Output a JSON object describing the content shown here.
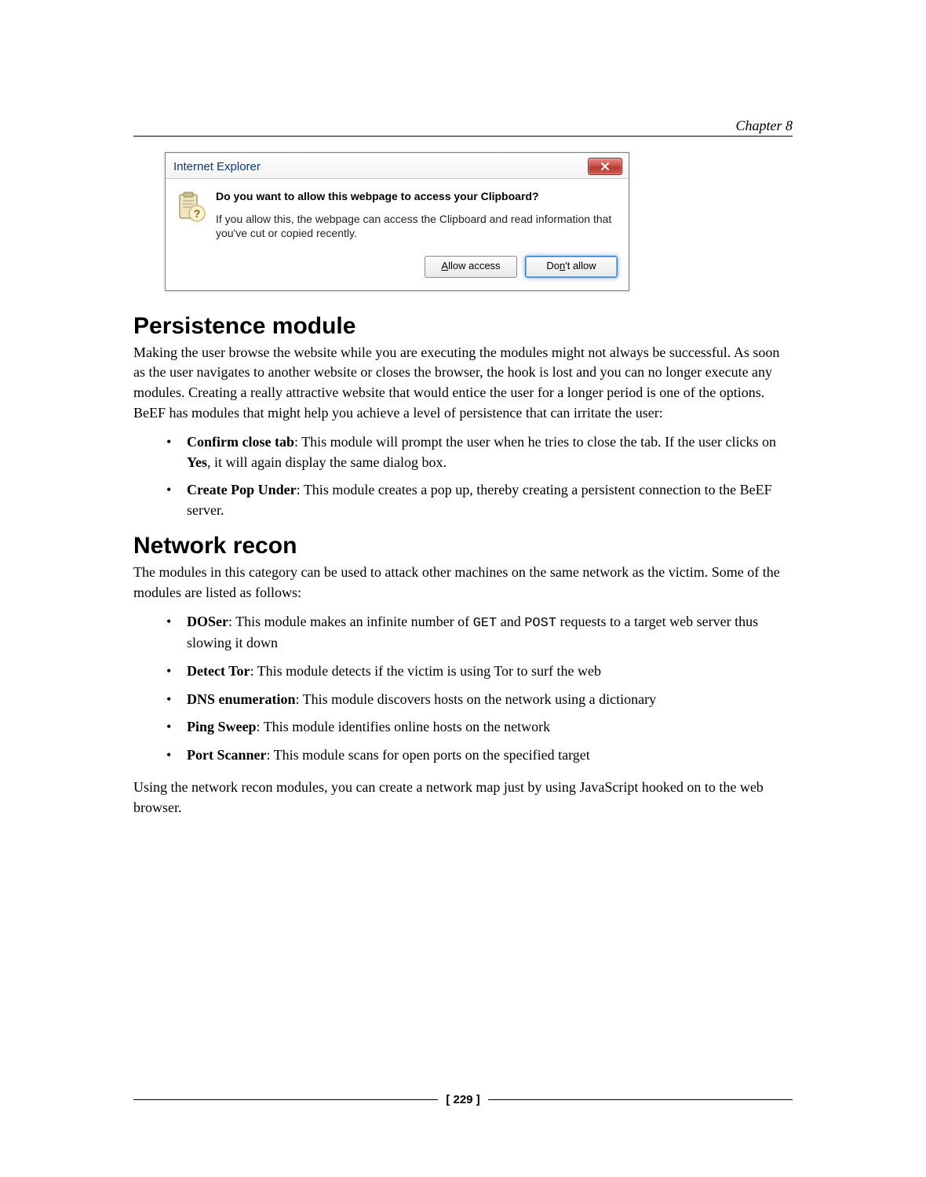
{
  "chapter_label": "Chapter 8",
  "dialog": {
    "title": "Internet Explorer",
    "heading": "Do you want to allow this webpage to access your Clipboard?",
    "message": "If you allow this, the webpage can access the Clipboard and read information that you've cut or copied recently.",
    "allow_prefix": "A",
    "allow_rest": "llow access",
    "dont_prefix": "Do",
    "dont_underline": "n",
    "dont_rest": "'t allow"
  },
  "sections": {
    "persistence": {
      "title": "Persistence module",
      "intro": "Making the user browse the website while you are executing the modules might not always be successful. As soon as the user navigates to another website or closes the browser, the hook is lost and you can no longer execute any modules. Creating a really attractive website that would entice the user for a longer period is one of the options. BeEF has modules that might help you achieve a level of persistence that can irritate the user:",
      "items": [
        {
          "bold": "Confirm close tab",
          "rest_before_yes": ": This module will prompt the user when he tries to close the tab. If the user clicks on ",
          "yes": "Yes",
          "rest_after_yes": ", it will again display the same dialog box."
        },
        {
          "bold": "Create Pop Under",
          "rest": ": This module creates a pop up, thereby creating a persistent connection to the BeEF server."
        }
      ]
    },
    "network": {
      "title": "Network recon",
      "intro": "The modules in this category can be used to attack other machines on the same network as the victim. Some of the modules are listed as follows:",
      "items": [
        {
          "bold": "DOSer",
          "pre": ": This module makes an infinite number of ",
          "code1": "GET",
          "mid": " and ",
          "code2": "POST",
          "post": " requests to a target web server thus slowing it down"
        },
        {
          "bold": "Detect Tor",
          "rest": ": This module detects if the victim is using Tor to surf the web"
        },
        {
          "bold": "DNS enumeration",
          "rest": ": This module discovers hosts on the network using a dictionary"
        },
        {
          "bold": "Ping Sweep",
          "rest": ": This module identifies online hosts on the network"
        },
        {
          "bold": "Port Scanner",
          "rest": ": This module scans for open ports on the specified target"
        }
      ],
      "outro": "Using the network recon modules, you can create a network map just by using JavaScript hooked on to the web browser."
    }
  },
  "page_number": "[ 229 ]"
}
